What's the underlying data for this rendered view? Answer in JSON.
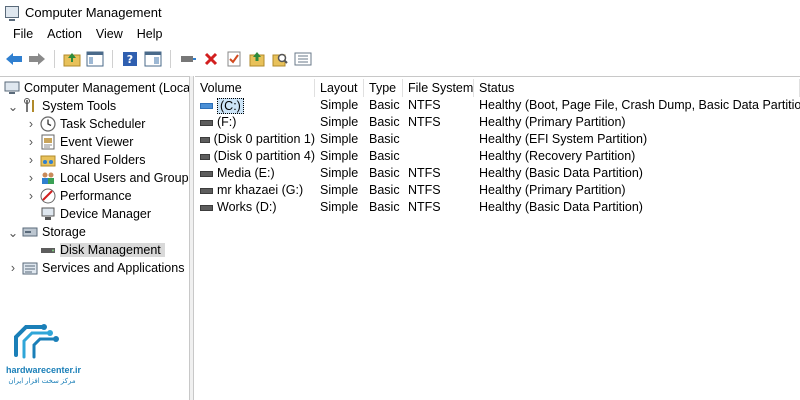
{
  "window": {
    "title": "Computer Management"
  },
  "menu": [
    "File",
    "Action",
    "View",
    "Help"
  ],
  "toolbar": {
    "buttons": [
      "back-arrow-icon",
      "forward-arrow-icon",
      "up-folder-icon",
      "show-hide-tree-icon",
      "help-icon",
      "properties-panel-icon",
      "connect-icon",
      "delete-icon",
      "check-icon",
      "up-arrow-icon",
      "search-icon",
      "list-icon"
    ]
  },
  "tree": {
    "root": "Computer Management (Local",
    "system_tools": "System Tools",
    "task_scheduler": "Task Scheduler",
    "event_viewer": "Event Viewer",
    "shared_folders": "Shared Folders",
    "local_users": "Local Users and Groups",
    "performance": "Performance",
    "device_manager": "Device Manager",
    "storage": "Storage",
    "disk_management": "Disk Management",
    "services": "Services and Applications"
  },
  "table": {
    "columns": [
      "Volume",
      "Layout",
      "Type",
      "File System",
      "Status"
    ],
    "rows": [
      [
        "(C:)",
        "Simple",
        "Basic",
        "NTFS",
        "Healthy (Boot, Page File, Crash Dump, Basic Data Partition)"
      ],
      [
        "(F:)",
        "Simple",
        "Basic",
        "NTFS",
        "Healthy (Primary Partition)"
      ],
      [
        "(Disk 0 partition 1)",
        "Simple",
        "Basic",
        "",
        "Healthy (EFI System Partition)"
      ],
      [
        "(Disk 0 partition 4)",
        "Simple",
        "Basic",
        "",
        "Healthy (Recovery Partition)"
      ],
      [
        "Media (E:)",
        "Simple",
        "Basic",
        "NTFS",
        "Healthy (Basic Data Partition)"
      ],
      [
        "mr khazaei  (G:)",
        "Simple",
        "Basic",
        "NTFS",
        "Healthy (Primary Partition)"
      ],
      [
        "Works (D:)",
        "Simple",
        "Basic",
        "NTFS",
        "Healthy (Basic Data Partition)"
      ]
    ]
  },
  "watermark": {
    "brand": "hardwarecenter.ir",
    "tagline": "مرکز سخت افزار ایران"
  },
  "colors": {
    "accent": "#1a7fb8",
    "selection": "#d9d9d9",
    "delete": "#d21f1f"
  }
}
